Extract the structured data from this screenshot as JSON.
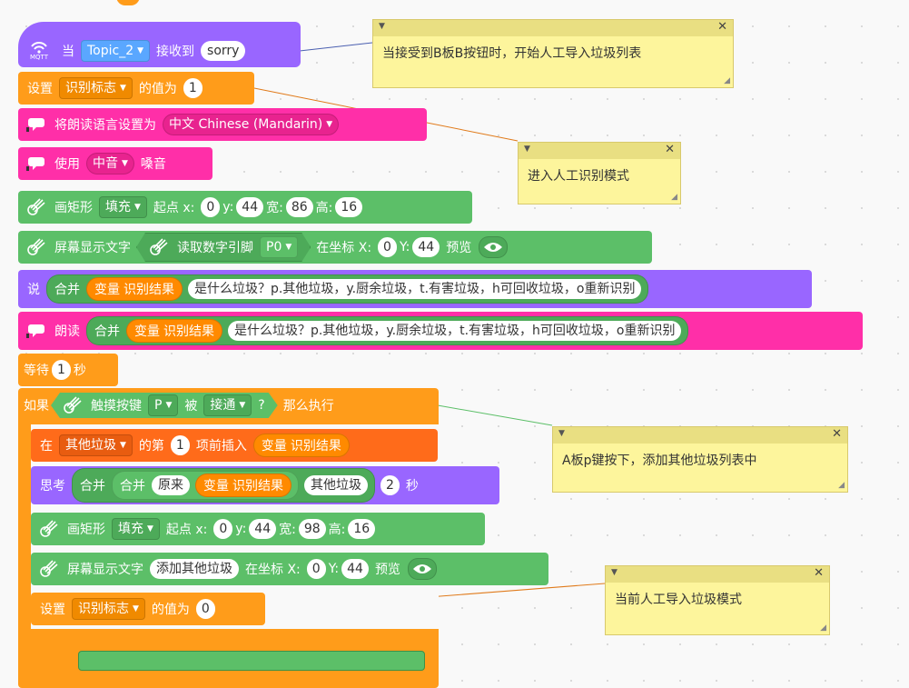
{
  "top_hat": {
    "label": "⚡"
  },
  "mqtt": {
    "icon_text": "MQTT",
    "when": "当",
    "topic": "Topic_2",
    "received": "接收到",
    "message": "sorry"
  },
  "set_flag1": {
    "set": "设置",
    "var": "识别标志",
    "value_of": "的值为",
    "value": "1"
  },
  "tts_lang": {
    "label": "将朗读语言设置为",
    "lang": "中文 Chinese (Mandarin)"
  },
  "tts_voice": {
    "use": "使用",
    "voice": "中音",
    "sound": "嗓音"
  },
  "rect1": {
    "label": "画矩形",
    "mode": "填充",
    "start": "起点 x:",
    "x": "0",
    "ylabel": "y:",
    "y": "44",
    "wlabel": "宽:",
    "w": "86",
    "hlabel": "高:",
    "h": "16"
  },
  "screen1": {
    "label": "屏幕显示文字",
    "read": "读取数字引脚",
    "pin": "P0",
    "at": "在坐标 X:",
    "x": "0",
    "ylabel": "Y:",
    "y": "44",
    "preview": "预览"
  },
  "say": {
    "say": "说",
    "join": "合并",
    "var_label": "变量",
    "var": "识别结果",
    "text": "是什么垃圾？p.其他垃圾，y.厨余垃圾，t.有害垃圾，h可回收垃圾，o重新识别"
  },
  "speak": {
    "speak": "朗读",
    "join": "合并",
    "var_label": "变量",
    "var": "识别结果",
    "text": "是什么垃圾？p.其他垃圾，y.厨余垃圾，t.有害垃圾，h可回收垃圾，o重新识别"
  },
  "wait": {
    "wait": "等待",
    "value": "1",
    "sec": "秒"
  },
  "if_block": {
    "if": "如果",
    "touch": "触摸按键",
    "key": "P",
    "be": "被",
    "state": "接通",
    "q": "?",
    "then": "那么执行"
  },
  "insert": {
    "in": "在",
    "list": "其他垃圾",
    "nth": "的第",
    "index": "1",
    "before": "项前插入",
    "var_label": "变量",
    "var": "识别结果"
  },
  "think": {
    "think": "思考",
    "join": "合并",
    "join2": "合并",
    "orig": "原来",
    "var_label": "变量",
    "var": "识别结果",
    "other": "其他垃圾",
    "secs": "2",
    "sec": "秒"
  },
  "rect2": {
    "label": "画矩形",
    "mode": "填充",
    "start": "起点 x:",
    "x": "0",
    "ylabel": "y:",
    "y": "44",
    "wlabel": "宽:",
    "w": "98",
    "hlabel": "高:",
    "h": "16"
  },
  "screen2": {
    "label": "屏幕显示文字",
    "text": "添加其他垃圾",
    "at": "在坐标 X:",
    "x": "0",
    "ylabel": "Y:",
    "y": "44",
    "preview": "预览"
  },
  "set_flag0": {
    "set": "设置",
    "var": "识别标志",
    "value_of": "的值为",
    "value": "0"
  },
  "comments": [
    {
      "text": "当接受到B板B按钮时，开始人工导入垃圾列表"
    },
    {
      "text": "进入人工识别模式"
    },
    {
      "text": "A板p键按下，添加其他垃圾列表中"
    },
    {
      "text": "当前人工导入垃圾模式"
    }
  ],
  "colors": {
    "event": "#9966ff",
    "data": "#ff9c1a",
    "tts": "#ff2fa8",
    "screen": "#5cbf68",
    "control": "#ff9c1a",
    "list": "#ff6b1a",
    "comment": "#fdf59c"
  }
}
